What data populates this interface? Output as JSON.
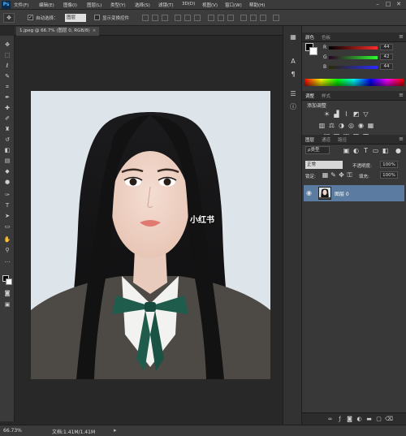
{
  "app": {
    "logo": "Ps",
    "menus": [
      "文件(F)",
      "编辑(E)",
      "图像(I)",
      "图层(L)",
      "类型(Y)",
      "选择(S)",
      "滤镜(T)",
      "3D(D)",
      "视图(V)",
      "窗口(W)",
      "帮助(H)"
    ],
    "window_controls": [
      "–",
      "□",
      "✕"
    ]
  },
  "options_bar": {
    "auto_select_label": "自动选择：",
    "auto_select_checked": "✓",
    "auto_select_target": "图层",
    "show_transform_label": "显示变换控件",
    "show_transform_checked": ""
  },
  "document": {
    "tab_title": "1.jpeg @ 66.7% (图层 0, RGB/8)",
    "tab_close": "×",
    "watermark": "小红书"
  },
  "status": {
    "zoom": "66.73%",
    "doc_size": "文档:1.41M/1.41M",
    "arrow": "▸"
  },
  "color_panel": {
    "tabs": [
      "颜色",
      "色板"
    ],
    "sliders": [
      {
        "label": "R",
        "value": "44",
        "gradient": [
          "#000000",
          "#ff2c2a"
        ]
      },
      {
        "label": "G",
        "value": "42",
        "gradient": [
          "#2c002a",
          "#2cff2a"
        ]
      },
      {
        "label": "B",
        "value": "44",
        "gradient": [
          "#2c2a00",
          "#2c2aff"
        ]
      }
    ],
    "foreground": "#000000",
    "background": "#ffffff"
  },
  "adjustments_panel": {
    "tabs": [
      "调整",
      "样式"
    ],
    "title": "添加调整"
  },
  "layers_panel": {
    "tabs": [
      "图层",
      "通道",
      "路径"
    ],
    "filter": "ρ类型",
    "blend_mode": "正常",
    "opacity_label": "不透明度:",
    "opacity_value": "100%",
    "lock_label": "锁定:",
    "fill_label": "填充:",
    "fill_value": "100%",
    "layers": [
      {
        "name": "图层 0",
        "visible": "◉",
        "selected": true
      }
    ],
    "footer_icons": [
      "link-icon",
      "fx-icon",
      "mask-icon",
      "adjustment-icon",
      "folder-icon",
      "new-layer-icon",
      "trash-icon"
    ]
  },
  "colors": {
    "accent_selection": "#5b7ca0",
    "panel_bg": "#383838",
    "canvas_bg": "#282828",
    "photo_bg": "#dde4ea"
  }
}
